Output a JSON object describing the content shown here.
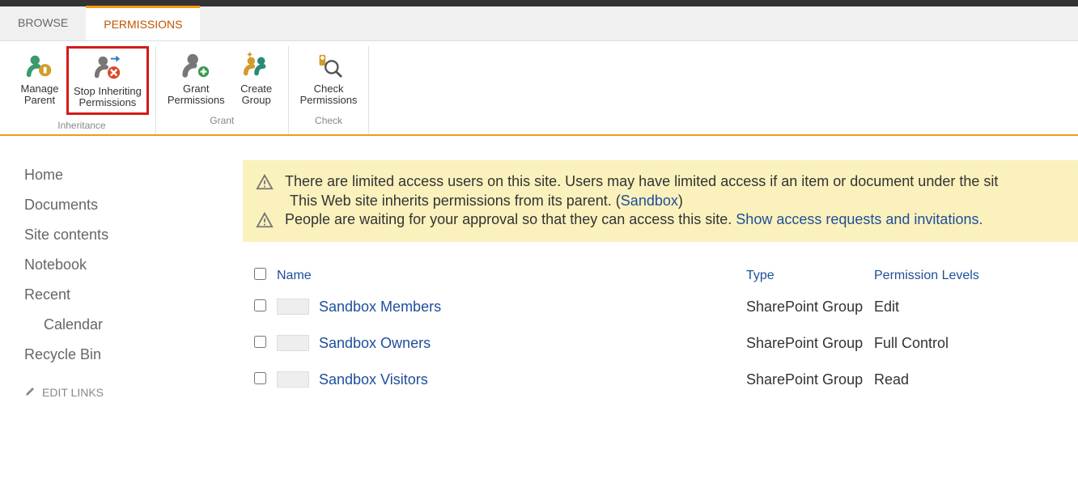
{
  "tabs": {
    "browse": "BROWSE",
    "permissions": "PERMISSIONS"
  },
  "ribbon": {
    "inheritance": {
      "group_name": "Inheritance",
      "manage_parent": "Manage\nParent",
      "stop_inheriting": "Stop Inheriting\nPermissions"
    },
    "grant": {
      "group_name": "Grant",
      "grant_permissions": "Grant\nPermissions",
      "create_group": "Create\nGroup"
    },
    "check": {
      "group_name": "Check",
      "check_permissions": "Check\nPermissions"
    }
  },
  "sidebar": {
    "home": "Home",
    "documents": "Documents",
    "site_contents": "Site contents",
    "notebook": "Notebook",
    "recent": "Recent",
    "calendar": "Calendar",
    "recycle_bin": "Recycle Bin",
    "edit_links": "EDIT LINKS"
  },
  "notice": {
    "limited_access": "There are limited access users on this site. Users may have limited access if an item or document under the sit",
    "inherits_prefix": "This Web site inherits permissions from its parent. (",
    "inherits_link": "Sandbox",
    "inherits_suffix": ")",
    "approval_prefix": "People are waiting for your approval so that they can access this site. ",
    "approval_link": "Show access requests and invitations."
  },
  "table": {
    "headers": {
      "name": "Name",
      "type": "Type",
      "perm": "Permission Levels"
    },
    "rows": [
      {
        "name": "Sandbox Members",
        "type": "SharePoint Group",
        "perm": "Edit"
      },
      {
        "name": "Sandbox Owners",
        "type": "SharePoint Group",
        "perm": "Full Control"
      },
      {
        "name": "Sandbox Visitors",
        "type": "SharePoint Group",
        "perm": "Read"
      }
    ]
  }
}
